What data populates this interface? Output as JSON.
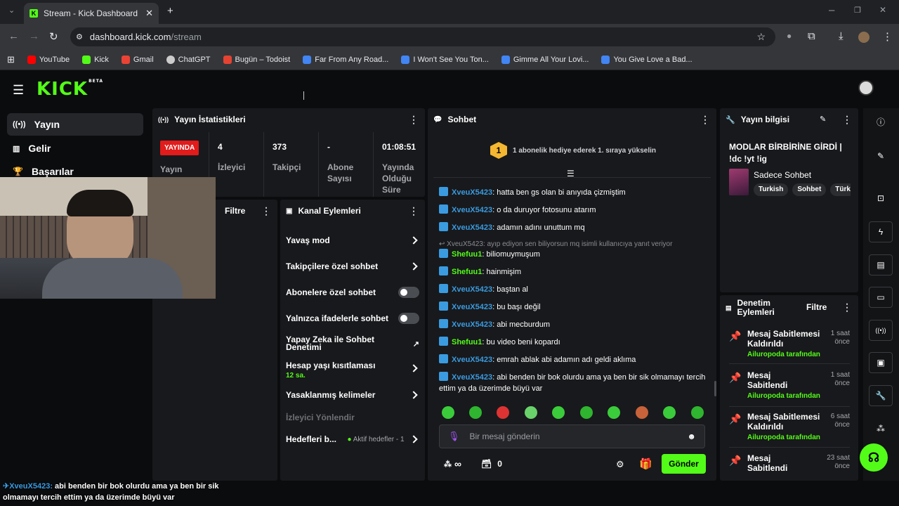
{
  "browser": {
    "tab_title": "Stream - Kick Dashboard",
    "url_host": "dashboard.kick.com",
    "url_path": "/stream",
    "bookmarks": [
      {
        "label": "YouTube",
        "color": "#ff0000"
      },
      {
        "label": "Kick",
        "color": "#53fc18"
      },
      {
        "label": "Gmail",
        "color": "#ea4335"
      },
      {
        "label": "ChatGPT",
        "color": "#cccccc"
      },
      {
        "label": "Bugün – Todoist",
        "color": "#e44332"
      },
      {
        "label": "Far From Any Road...",
        "color": "#4285f4"
      },
      {
        "label": "I Won't See You Ton...",
        "color": "#4285f4"
      },
      {
        "label": "Gimme All Your Lovi...",
        "color": "#4285f4"
      },
      {
        "label": "You Give Love a Bad...",
        "color": "#4285f4"
      }
    ]
  },
  "logo": {
    "text": "KICK",
    "badge": "BETA"
  },
  "sidebar": {
    "items": [
      {
        "label": "Yayın",
        "icon": "broadcast-icon"
      },
      {
        "label": "Gelir",
        "icon": "chart-icon"
      },
      {
        "label": "Başarılar",
        "icon": "trophy-icon"
      }
    ]
  },
  "stats": {
    "title": "Yayın İstatistikleri",
    "live_badge": "YAYINDA",
    "live_label": "Yayın",
    "items": [
      {
        "value": "4",
        "label": "İzleyici"
      },
      {
        "value": "373",
        "label": "Takipçi"
      },
      {
        "value": "-",
        "label": "Abone Sayısı"
      },
      {
        "value": "01:08:51",
        "label": "Yayında Olduğu Süre"
      }
    ]
  },
  "filter": {
    "label": "Filtre"
  },
  "actions": {
    "title": "Kanal Eylemleri",
    "items": [
      "Yavaş mod",
      "Takipçilere özel sohbet",
      "Abonelere özel sohbet",
      "Yalnızca ifadelerle sohbet",
      "Yapay Zeka ile Sohbet Denetimi",
      "Hesap yaşı kısıtlaması",
      "Yasaklanmış kelimeler",
      "İzleyici Yönlendir",
      "Hedefleri b..."
    ],
    "age_value": "12 sa.",
    "goals_status": "Aktif hedefler - 1"
  },
  "chat": {
    "title": "Sohbet",
    "promo": "1 abonelik hediye ederek 1. sıraya yükselin",
    "promo_rank": "1",
    "reply_note": "XveuX5423: ayıp ediyon sen biliyorsun mq isimli kullanıcıya yanıt veriyor",
    "messages": [
      {
        "user": "XveuX5423",
        "text": "hatta ben gs olan bi anıyıda çizmiştim"
      },
      {
        "user": "XveuX5423",
        "text": "o da duruyor fotosunu atarım"
      },
      {
        "user": "XveuX5423",
        "text": "adamın adını unuttum mq"
      },
      {
        "user": "Shefuu1",
        "text": "biliomuymuşum"
      },
      {
        "user": "Shefuu1",
        "text": "hainmişim"
      },
      {
        "user": "XveuX5423",
        "text": "baştan al"
      },
      {
        "user": "XveuX5423",
        "text": "bu başı değil"
      },
      {
        "user": "XveuX5423",
        "text": "abi mecburdum"
      },
      {
        "user": "Shefuu1",
        "text": "bu video beni kopardı"
      },
      {
        "user": "XveuX5423",
        "text": "emrah ablak abi adamın adı geldi aklıma"
      },
      {
        "user": "XveuX5423",
        "text": "abi benden bir bok olurdu ama ya ben bir sik olmamayı tercih ettim ya da üzerimde büyü var"
      }
    ],
    "input_placeholder": "Bir mesaj gönderin",
    "points": "∞",
    "gift_count": "0",
    "send_label": "Gönder"
  },
  "info": {
    "title": "Yayın bilgisi",
    "stream_title": "MODLAR BİRBİRİNE GİRDİ | !dc !yt !ig",
    "category": "Sadece Sohbet",
    "tags": [
      "Turkish",
      "Sohbet",
      "Türk"
    ]
  },
  "mod": {
    "title": "Denetim Eylemleri",
    "filter": "Filtre",
    "items": [
      {
        "action": "Mesaj Sabitlemesi Kaldırıldı",
        "by": "Ailuropoda tarafından",
        "time": "1 saat önce"
      },
      {
        "action": "Mesaj Sabitlendi",
        "by": "Ailuropoda tarafından",
        "time": "1 saat önce"
      },
      {
        "action": "Mesaj Sabitlemesi Kaldırıldı",
        "by": "Ailuropoda tarafından",
        "time": "6 saat önce"
      },
      {
        "action": "Mesaj Sabitlendi",
        "by": "",
        "time": "23 saat önce"
      }
    ]
  },
  "overlay": {
    "user": "XveuX5423:",
    "text": "abi benden bir bok olurdu ama ya ben bir sik olmamayı tercih ettim ya da üzerimde büyü var"
  }
}
